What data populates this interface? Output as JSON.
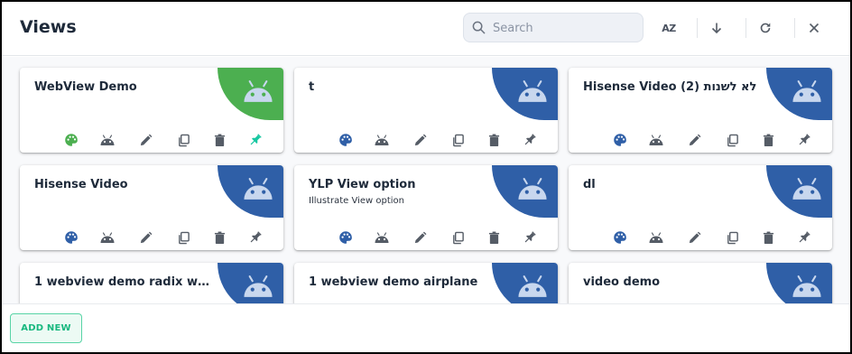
{
  "header": {
    "title": "Views",
    "search_placeholder": "Search",
    "sort_az_label": "AZ"
  },
  "colors": {
    "blob_green": "#4caf50",
    "blob_blue": "#2f5fa7",
    "android_on_blob": "#c8d7ee",
    "icon_gray": "#555c66",
    "accent_teal": "#18c7a1"
  },
  "cards": [
    {
      "title": "WebView Demo",
      "description": "",
      "blob_color": "green",
      "palette_color": "green",
      "pinned": true
    },
    {
      "title": "t",
      "description": "",
      "blob_color": "blue",
      "palette_color": "blue",
      "pinned": false
    },
    {
      "title": "Hisense Video (2) לא לשנות",
      "description": "",
      "blob_color": "blue",
      "palette_color": "blue",
      "pinned": false
    },
    {
      "title": "Hisense Video",
      "description": "",
      "blob_color": "blue",
      "palette_color": "blue",
      "pinned": false
    },
    {
      "title": "YLP View option",
      "description": "Illustrate View option",
      "blob_color": "blue",
      "palette_color": "blue",
      "pinned": false
    },
    {
      "title": "dl",
      "description": "",
      "blob_color": "blue",
      "palette_color": "blue",
      "pinned": false
    },
    {
      "title": "1 webview demo radix we...",
      "description": "",
      "blob_color": "blue",
      "palette_color": "blue",
      "pinned": false
    },
    {
      "title": "1 webview demo airplane",
      "description": "",
      "blob_color": "blue",
      "palette_color": "blue",
      "pinned": false
    },
    {
      "title": "video demo",
      "description": "",
      "blob_color": "blue",
      "palette_color": "blue",
      "pinned": false
    }
  ],
  "card_action_icons": [
    "palette-icon",
    "android-icon",
    "edit-icon",
    "duplicate-icon",
    "delete-icon",
    "pin-icon"
  ],
  "footer": {
    "add_new_label": "ADD NEW"
  }
}
